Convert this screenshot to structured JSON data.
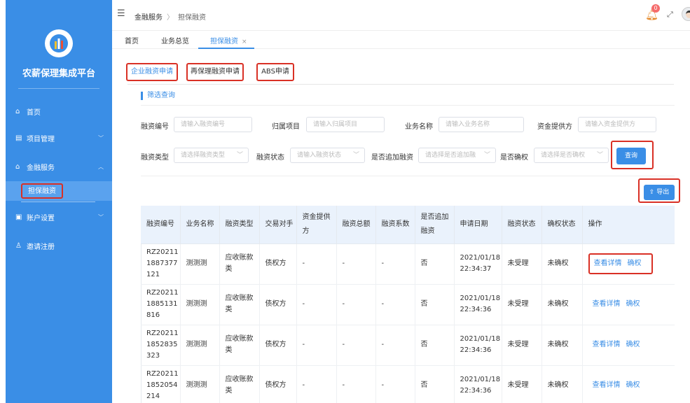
{
  "sidebar": {
    "brand": "农薪保理集成平台",
    "items": [
      {
        "icon": "home-icon",
        "glyph": "⌂",
        "label": "首页"
      },
      {
        "icon": "project-icon",
        "glyph": "▤",
        "label": "项目管理",
        "chevron": "﹀"
      },
      {
        "icon": "finance-icon",
        "glyph": "⌂",
        "label": "金融服务",
        "chevron": "︿"
      },
      {
        "icon": "account-icon",
        "glyph": "▣",
        "label": "账户设置",
        "chevron": "﹀"
      },
      {
        "icon": "user-icon",
        "glyph": "♙",
        "label": "邀请注册"
      }
    ],
    "active_sub": "担保融资"
  },
  "header": {
    "breadcrumb": [
      "金融服务",
      "担保融资"
    ],
    "notification_count": "0"
  },
  "page_tabs": [
    {
      "label": "首页"
    },
    {
      "label": "业务总览"
    },
    {
      "label": "担保融资",
      "close": "×"
    }
  ],
  "sub_tabs": [
    "企业融资申请",
    "再保理融资申请",
    "ABS申请"
  ],
  "filter": {
    "title": "筛选查询",
    "row1": [
      {
        "label": "融资编号",
        "placeholder": "请输入融资编号"
      },
      {
        "label": "归属项目",
        "placeholder": "请输入归属项目"
      },
      {
        "label": "业务名称",
        "placeholder": "请输入业务名称"
      },
      {
        "label": "资金提供方",
        "placeholder": "请输入资金提供方"
      }
    ],
    "row2": [
      {
        "label": "融资类型",
        "placeholder": "请选择融资类型"
      },
      {
        "label": "融资状态",
        "placeholder": "请输入融资状态"
      },
      {
        "label": "是否追加融资",
        "placeholder": "请选择是否追加融"
      },
      {
        "label": "是否确权",
        "placeholder": "请选择是否确权"
      }
    ],
    "query_label": "查询"
  },
  "export_label": "⇪ 导出",
  "table": {
    "headers": [
      "融资编号",
      "业务名称",
      "融资类型",
      "交易对手",
      "资金提供方",
      "融资总额",
      "融资系数",
      "是否追加融资",
      "申请日期",
      "融资状态",
      "确权状态",
      "操作"
    ],
    "rows": [
      {
        "id": "RZ202111887377121",
        "id_lines": [
          "RZ20211",
          "1887377",
          "121"
        ],
        "name": "测测测",
        "type": "应收账款类",
        "counterparty": "债权方",
        "provider": "-",
        "total": "-",
        "ratio": "-",
        "append": "否",
        "date": "2021/01/18",
        "time": "22:34:37",
        "status": "未受理",
        "confirm": "未确权",
        "op_detail": "查看详情",
        "op_confirm": "确权"
      },
      {
        "id": "RZ202111885131816",
        "id_lines": [
          "RZ20211",
          "1885131",
          "816"
        ],
        "name": "测测测",
        "type": "应收账款类",
        "counterparty": "债权方",
        "provider": "-",
        "total": "-",
        "ratio": "-",
        "append": "否",
        "date": "2021/01/18",
        "time": "22:34:36",
        "status": "未受理",
        "confirm": "未确权",
        "op_detail": "查看详情",
        "op_confirm": "确权"
      },
      {
        "id": "RZ202111852835323",
        "id_lines": [
          "RZ20211",
          "1852835",
          "323"
        ],
        "name": "测测测",
        "type": "应收账款类",
        "counterparty": "债权方",
        "provider": "-",
        "total": "-",
        "ratio": "-",
        "append": "否",
        "date": "2021/01/18",
        "time": "22:34:36",
        "status": "未受理",
        "confirm": "未确权",
        "op_detail": "查看详情",
        "op_confirm": "确权"
      },
      {
        "id": "RZ202111852054214",
        "id_lines": [
          "RZ20211",
          "1852054",
          "214"
        ],
        "name": "测测测",
        "type": "应收账款类",
        "counterparty": "债权方",
        "provider": "-",
        "total": "-",
        "ratio": "-",
        "append": "否",
        "date": "2021/01/18",
        "time": "22:34:36",
        "status": "未受理",
        "confirm": "未确权",
        "op_detail": "查看详情",
        "op_confirm": "确权"
      }
    ]
  },
  "colors": {
    "primary": "#3a8ee6",
    "highlight": "#d93025",
    "sidebar": "#3a8ee6"
  }
}
